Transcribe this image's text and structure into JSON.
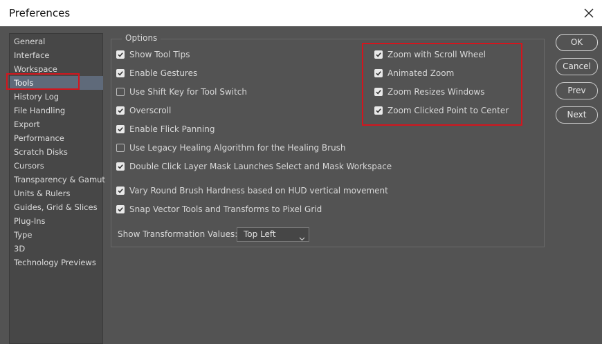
{
  "window": {
    "title": "Preferences"
  },
  "sidebar": {
    "items": [
      {
        "label": "General"
      },
      {
        "label": "Interface"
      },
      {
        "label": "Workspace"
      },
      {
        "label": "Tools",
        "selected": true
      },
      {
        "label": "History Log"
      },
      {
        "label": "File Handling"
      },
      {
        "label": "Export"
      },
      {
        "label": "Performance"
      },
      {
        "label": "Scratch Disks"
      },
      {
        "label": "Cursors"
      },
      {
        "label": "Transparency & Gamut"
      },
      {
        "label": "Units & Rulers"
      },
      {
        "label": "Guides, Grid & Slices"
      },
      {
        "label": "Plug-Ins"
      },
      {
        "label": "Type"
      },
      {
        "label": "3D"
      },
      {
        "label": "Technology Previews"
      }
    ]
  },
  "options": {
    "title": "Options",
    "left": [
      {
        "label": "Show Tool Tips",
        "checked": true
      },
      {
        "label": "Enable Gestures",
        "checked": true
      },
      {
        "label": "Use Shift Key for Tool Switch",
        "checked": false
      },
      {
        "label": "Overscroll",
        "checked": true
      },
      {
        "label": "Enable Flick Panning",
        "checked": true
      },
      {
        "label": "Use Legacy Healing Algorithm for the Healing Brush",
        "checked": false
      },
      {
        "label": "Double Click Layer Mask Launches Select and Mask Workspace",
        "checked": true
      },
      {
        "label": "Vary Round Brush Hardness based on HUD vertical movement",
        "checked": true
      },
      {
        "label": "Snap Vector Tools and Transforms to Pixel Grid",
        "checked": true
      }
    ],
    "right": [
      {
        "label": "Zoom with Scroll Wheel",
        "checked": true
      },
      {
        "label": "Animated Zoom",
        "checked": true
      },
      {
        "label": "Zoom Resizes Windows",
        "checked": true
      },
      {
        "label": "Zoom Clicked Point to Center",
        "checked": true
      }
    ],
    "transformation": {
      "label": "Show Transformation Values:",
      "value": "Top Left"
    }
  },
  "buttons": {
    "ok": "OK",
    "cancel": "Cancel",
    "prev": "Prev",
    "next": "Next"
  },
  "colors": {
    "highlight": "#d4151d",
    "background": "#535353",
    "selected": "#5f6a7a"
  }
}
